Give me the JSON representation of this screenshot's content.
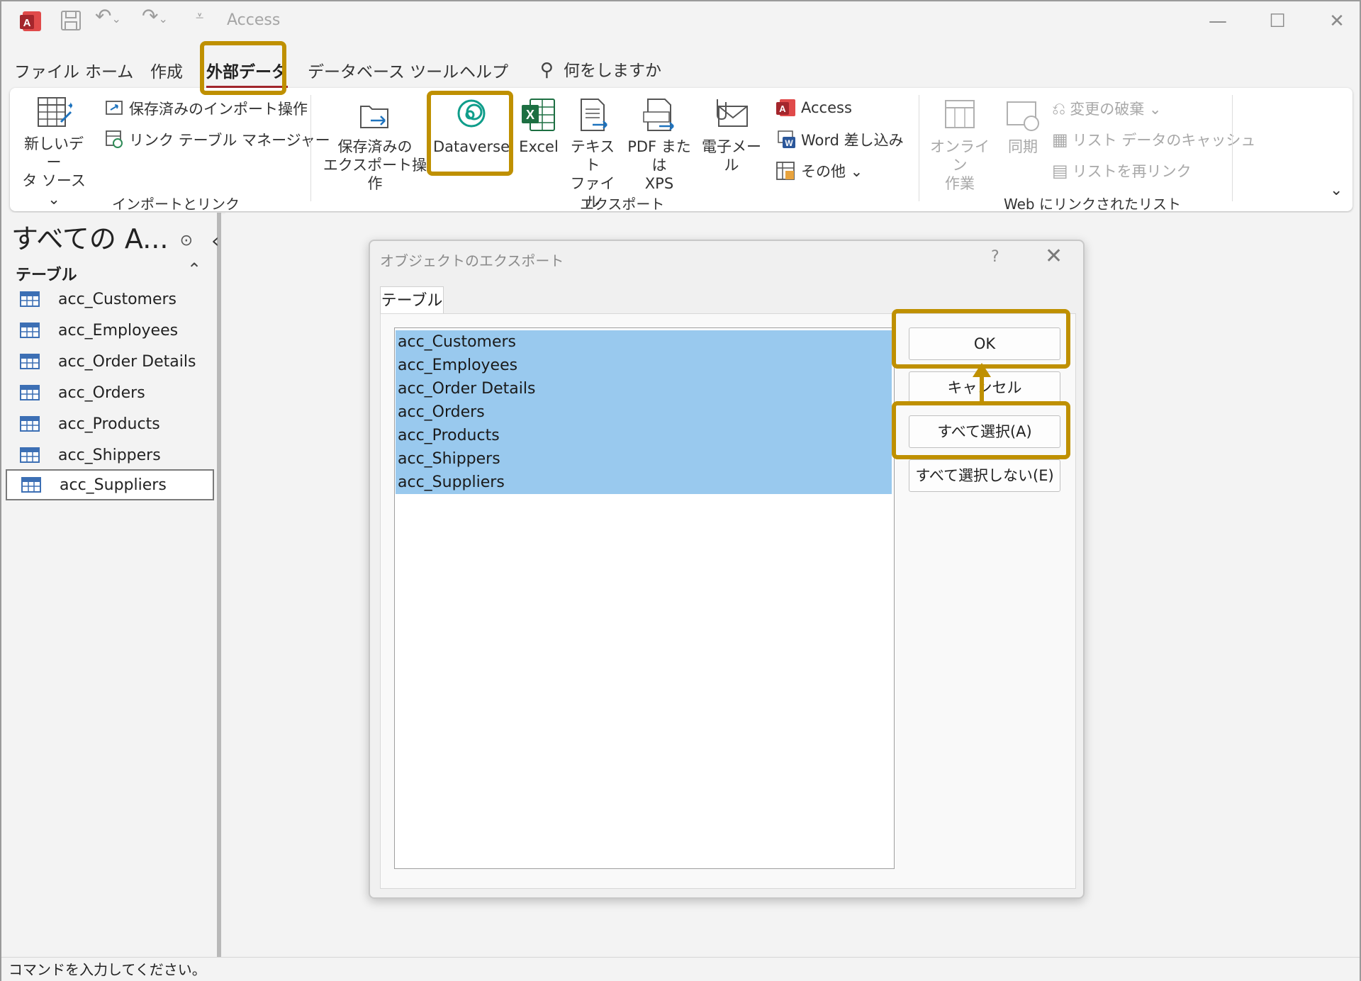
{
  "window": {
    "title": "Access",
    "minimize_glyph": "—",
    "maximize_glyph": "☐",
    "close_glyph": "✕"
  },
  "menu": {
    "tabs": [
      {
        "label": "ファイル"
      },
      {
        "label": "ホーム"
      },
      {
        "label": "作成"
      },
      {
        "label": "外部データ",
        "active": true
      },
      {
        "label": "データベース ツール"
      },
      {
        "label": "ヘルプ"
      }
    ],
    "search_label": "何をしますか"
  },
  "ribbon": {
    "import_link": {
      "new_source": "新しいデータ ソース",
      "new_source_line1": "新しいデー",
      "new_source_line2": "タ ソース ⌄",
      "saved_imports": "保存済みのインポート操作",
      "linked_table_manager": "リンク テーブル マネージャー",
      "group_label": "インポートとリンク"
    },
    "export": {
      "saved_exports_line1": "保存済みの",
      "saved_exports_line2": "エクスポート操作",
      "dataverse": "Dataverse",
      "excel": "Excel",
      "text_line1": "テキスト",
      "text_line2": "ファイル",
      "pdf_line1": "PDF または",
      "pdf_line2": "XPS",
      "email": "電子メール",
      "access": "Access",
      "word_merge": "Word 差し込み",
      "more": "その他 ⌄",
      "group_label": "エクスポート"
    },
    "web_lists": {
      "online_line1": "オンライン",
      "online_line2": "作業",
      "sync": "同期",
      "discard_changes": "変更の破棄 ⌄",
      "cache_list_data": "リスト データのキャッシュ",
      "relink_lists": "リストを再リンク",
      "group_label": "Web にリンクされたリスト"
    },
    "collapse_glyph": "⌄"
  },
  "nav": {
    "title": "すべての A...",
    "section": "テーブル",
    "items": [
      {
        "label": "acc_Customers"
      },
      {
        "label": "acc_Employees"
      },
      {
        "label": "acc_Order Details"
      },
      {
        "label": "acc_Orders"
      },
      {
        "label": "acc_Products"
      },
      {
        "label": "acc_Shippers"
      },
      {
        "label": "acc_Suppliers",
        "selected": true
      }
    ]
  },
  "dialog": {
    "title": "オブジェクトのエクスポート",
    "help": "?",
    "close": "✕",
    "tab": "テーブル",
    "items": [
      "acc_Customers",
      "acc_Employees",
      "acc_Order Details",
      "acc_Orders",
      "acc_Products",
      "acc_Shippers",
      "acc_Suppliers"
    ],
    "buttons": {
      "ok": "OK",
      "cancel": "キャンセル",
      "select_all": "すべて選択(A)",
      "deselect_all": "すべて選択しない(E)"
    }
  },
  "status": {
    "text": "コマンドを入力してください。"
  },
  "colors": {
    "highlight": "#bf9000",
    "selection": "#99c9ee",
    "active_tab_underline": "#a4262c"
  }
}
